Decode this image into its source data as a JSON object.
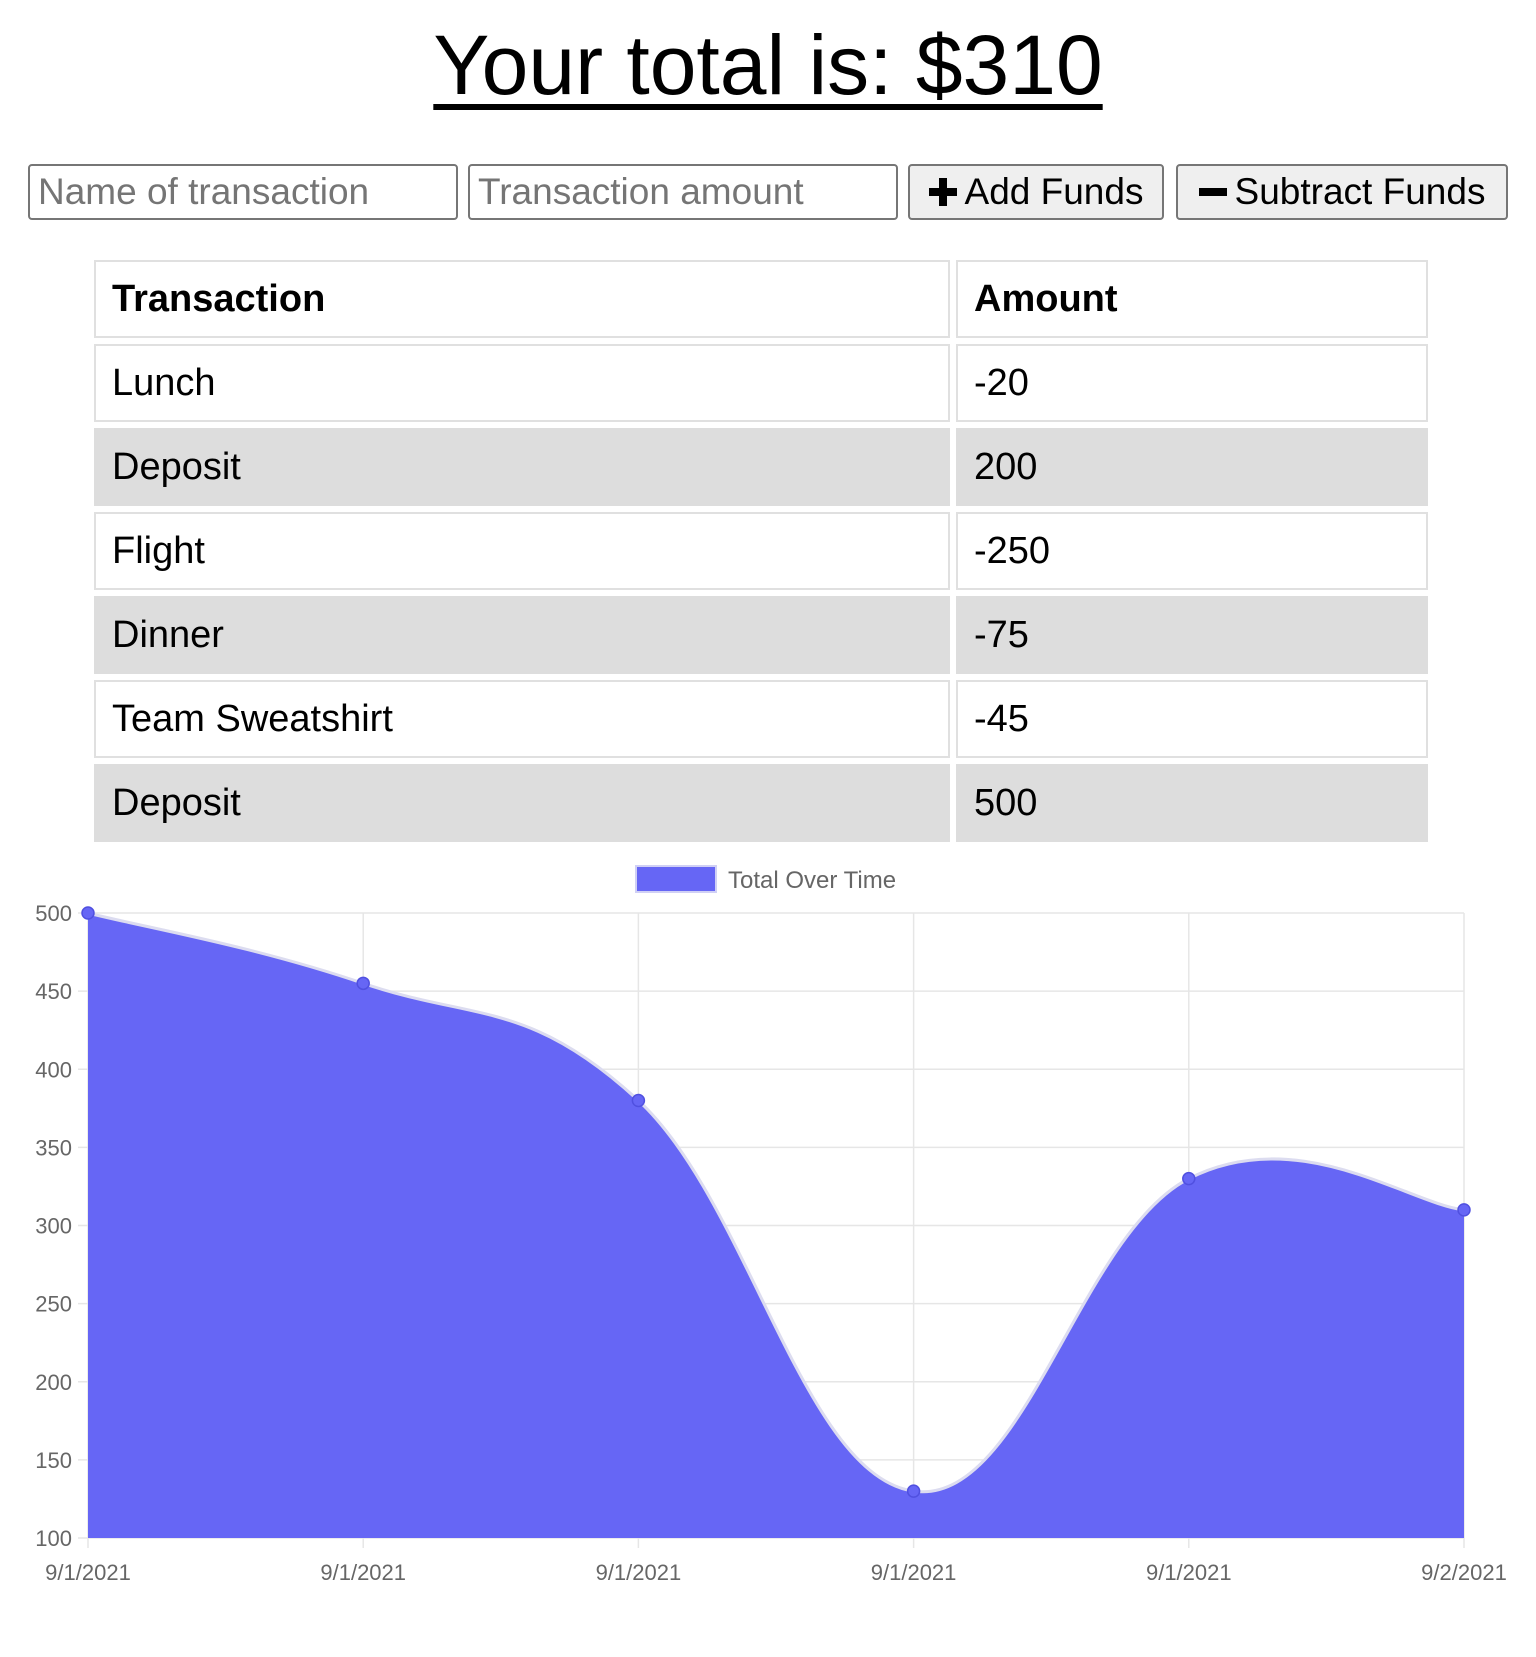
{
  "header": {
    "title": "Your total is: $310"
  },
  "form": {
    "name_placeholder": "Name of transaction",
    "amount_placeholder": "Transaction amount",
    "add_label": "Add Funds",
    "add_icon": "plus-icon",
    "subtract_label": "Subtract Funds",
    "subtract_icon": "minus-icon"
  },
  "table": {
    "headers": [
      "Transaction",
      "Amount"
    ],
    "rows": [
      {
        "name": "Lunch",
        "amount": "-20"
      },
      {
        "name": "Deposit",
        "amount": "200"
      },
      {
        "name": "Flight",
        "amount": "-250"
      },
      {
        "name": "Dinner",
        "amount": "-75"
      },
      {
        "name": "Team Sweatshirt",
        "amount": "-45"
      },
      {
        "name": "Deposit",
        "amount": "500"
      }
    ]
  },
  "chart_data": {
    "type": "area",
    "title": "",
    "xlabel": "",
    "ylabel": "",
    "x": [
      "9/1/2021",
      "9/1/2021",
      "9/1/2021",
      "9/1/2021",
      "9/1/2021",
      "9/2/2021"
    ],
    "series": [
      {
        "name": "Total Over Time",
        "values": [
          500,
          455,
          380,
          130,
          330,
          310
        ],
        "color": "#6666f5"
      }
    ],
    "ylim": [
      100,
      500
    ],
    "yticks": [
      100,
      150,
      200,
      250,
      300,
      350,
      400,
      450,
      500
    ],
    "grid": true,
    "legend": "top-center"
  }
}
